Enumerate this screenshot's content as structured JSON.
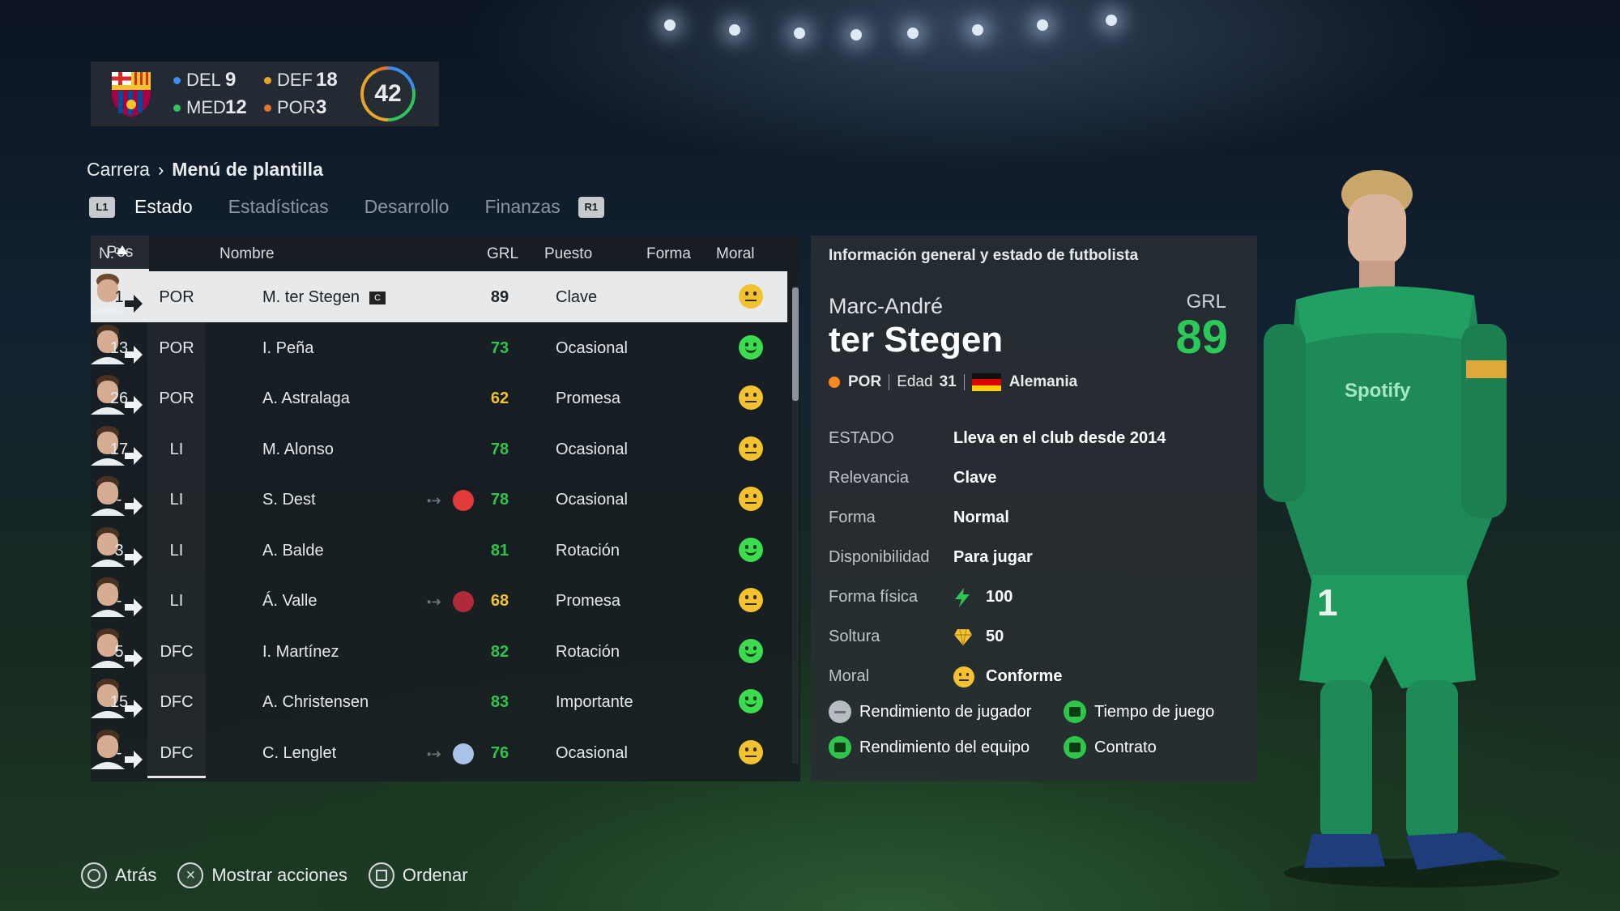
{
  "club": {
    "counts": [
      {
        "label": "DEL",
        "value": "9",
        "color": "#3c8df0"
      },
      {
        "label": "DEF",
        "value": "18",
        "color": "#e6a52a"
      },
      {
        "label": "MED",
        "value": "12",
        "color": "#2fc45c"
      },
      {
        "label": "POR",
        "value": "3",
        "color": "#e4732b"
      }
    ],
    "total": "42"
  },
  "breadcrumb": {
    "parent": "Carrera",
    "current": "Menú de plantilla"
  },
  "tabs": {
    "left_button": "L1",
    "right_button": "R1",
    "items": [
      "Estado",
      "Estadísticas",
      "Desarrollo",
      "Finanzas"
    ],
    "active": "Estado"
  },
  "table": {
    "headers": {
      "num": "N.º",
      "pos": "Pos",
      "name": "Nombre",
      "grl": "GRL",
      "role": "Puesto",
      "form": "Forma",
      "moral": "Moral"
    },
    "rows": [
      {
        "num": "1",
        "pos": "POR",
        "name": "M. ter Stegen",
        "captain": "C",
        "grl": "89",
        "grl_color": "#1d2124",
        "role": "Clave",
        "moral": "neutral",
        "selected": true
      },
      {
        "num": "13",
        "pos": "POR",
        "name": "I. Peña",
        "grl": "73",
        "grl_color": "#2fc54d",
        "role": "Ocasional",
        "moral": "happy"
      },
      {
        "num": "26",
        "pos": "POR",
        "name": "A. Astralaga",
        "grl": "62",
        "grl_color": "#f2c230",
        "role": "Promesa",
        "moral": "neutral"
      },
      {
        "num": "17",
        "pos": "LI",
        "name": "M. Alonso",
        "grl": "78",
        "grl_color": "#2fc54d",
        "role": "Ocasional",
        "moral": "neutral"
      },
      {
        "num": "-",
        "pos": "LI",
        "name": "S. Dest",
        "loan": true,
        "loan_club_color": "#e23b3b",
        "grl": "78",
        "grl_color": "#2fc54d",
        "role": "Ocasional",
        "moral": "neutral"
      },
      {
        "num": "3",
        "pos": "LI",
        "name": "A. Balde",
        "grl": "81",
        "grl_color": "#2fc54d",
        "role": "Rotación",
        "moral": "happy"
      },
      {
        "num": "-",
        "pos": "LI",
        "name": "Á. Valle",
        "loan": true,
        "loan_club_color": "#b02a3a",
        "grl": "68",
        "grl_color": "#f2c230",
        "role": "Promesa",
        "moral": "neutral"
      },
      {
        "num": "5",
        "pos": "DFC",
        "name": "I. Martínez",
        "grl": "82",
        "grl_color": "#2fc54d",
        "role": "Rotación",
        "moral": "happy"
      },
      {
        "num": "15",
        "pos": "DFC",
        "name": "A. Christensen",
        "grl": "83",
        "grl_color": "#2fc54d",
        "role": "Importante",
        "moral": "happy"
      },
      {
        "num": "-",
        "pos": "DFC",
        "name": "C. Lenglet",
        "loan": true,
        "loan_club_color": "#a9c3e6",
        "grl": "76",
        "grl_color": "#2fc54d",
        "role": "Ocasional",
        "moral": "neutral"
      }
    ]
  },
  "info": {
    "title": "Información general y estado de futbolista",
    "first_name": "Marc-André",
    "last_name": "ter Stegen",
    "grl_label": "GRL",
    "grl_value": "89",
    "position": "POR",
    "age_label": "Edad",
    "age": "31",
    "country": "Alemania",
    "stats": [
      {
        "key": "ESTADO",
        "value": "Lleva en el club desde 2014"
      },
      {
        "key": "Relevancia",
        "value": "Clave"
      },
      {
        "key": "Forma",
        "value": "Normal"
      },
      {
        "key": "Disponibilidad",
        "value": "Para jugar"
      },
      {
        "key": "Forma física",
        "value": "100",
        "icon": "bolt-icon"
      },
      {
        "key": "Soltura",
        "value": "50",
        "icon": "gem-icon"
      },
      {
        "key": "Moral",
        "value": "Conforme",
        "icon": "neutral-face-icon"
      }
    ],
    "factors": [
      {
        "label": "Rendimiento de jugador",
        "status": "neutral"
      },
      {
        "label": "Tiempo de juego",
        "status": "ok"
      },
      {
        "label": "Rendimiento del equipo",
        "status": "ok"
      },
      {
        "label": "Contrato",
        "status": "ok"
      }
    ]
  },
  "footer": {
    "back": "Atrás",
    "actions": "Mostrar acciones",
    "sort": "Ordenar"
  }
}
